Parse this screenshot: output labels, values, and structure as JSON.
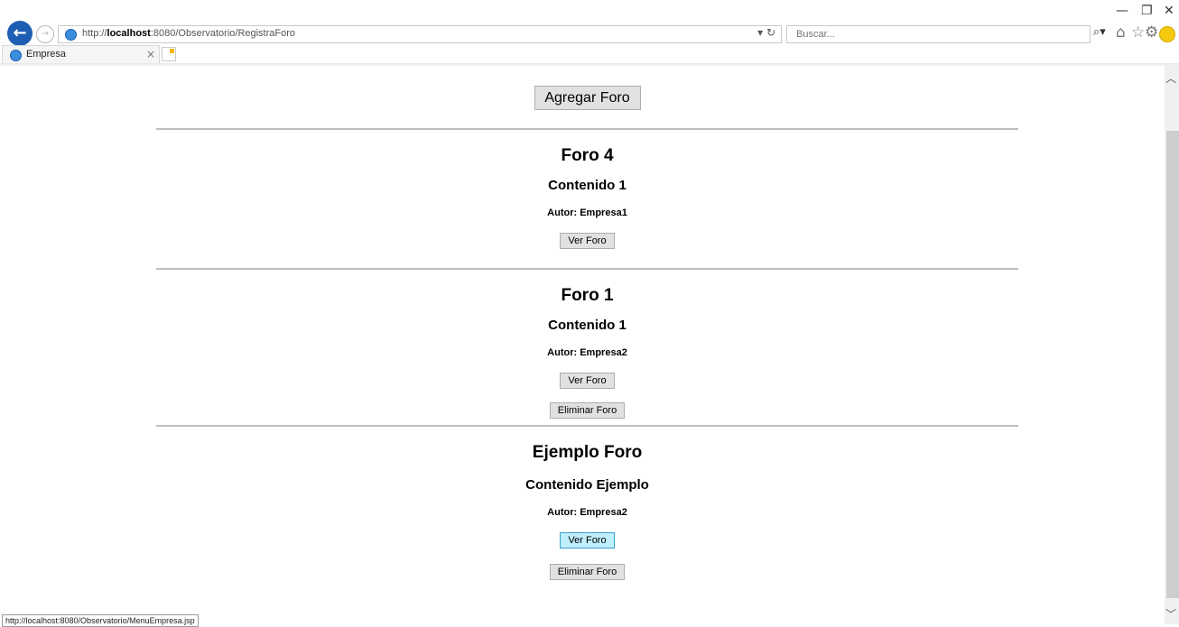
{
  "browser": {
    "url_prefix": "http://",
    "url_host": "localhost",
    "url_rest": ":8080/Observatorio/RegistraForo",
    "search_placeholder": "Buscar...",
    "tab_title": "Empresa",
    "status_url": "http://localhost:8080/Observatorio/MenuEmpresa.jsp"
  },
  "page": {
    "add_button": "Agregar Foro",
    "foros": [
      {
        "title": "Foro 4",
        "content": "Contenido 1",
        "author": "Autor: Empresa1",
        "view": "Ver Foro"
      },
      {
        "title": "Foro 1",
        "content": "Contenido 1",
        "author": "Autor: Empresa2",
        "view": "Ver Foro",
        "delete": "Eliminar Foro"
      },
      {
        "title": "Ejemplo Foro",
        "content": "Contenido Ejemplo",
        "author": "Autor: Empresa2",
        "view": "Ver Foro",
        "delete": "Eliminar Foro"
      }
    ]
  },
  "colors": {
    "accent_hover": "#bfeefd",
    "back_button": "#1e5fb4"
  }
}
